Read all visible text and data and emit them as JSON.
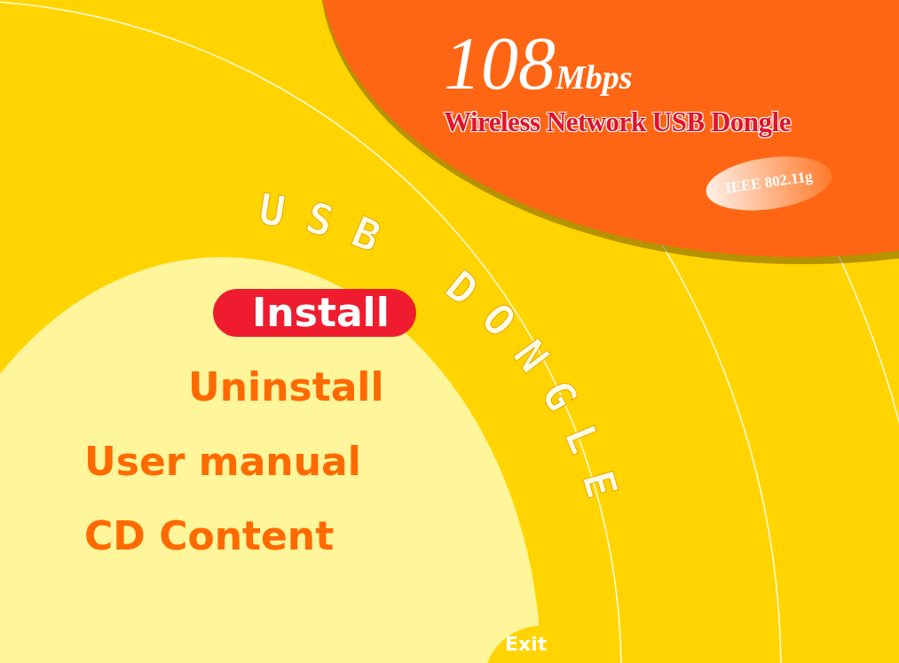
{
  "product": {
    "speed": "108",
    "unit": "Mbps",
    "name": "Wireless Network USB Dongle",
    "standard": "IEEE 802.11g"
  },
  "caption": [
    "USB",
    "DONGLE"
  ],
  "menu": [
    {
      "label": "Install",
      "selected": true
    },
    {
      "label": "Uninstall",
      "selected": false
    },
    {
      "label": "User manual",
      "selected": false
    },
    {
      "label": "CD Content",
      "selected": false
    }
  ],
  "exit": "Exit"
}
